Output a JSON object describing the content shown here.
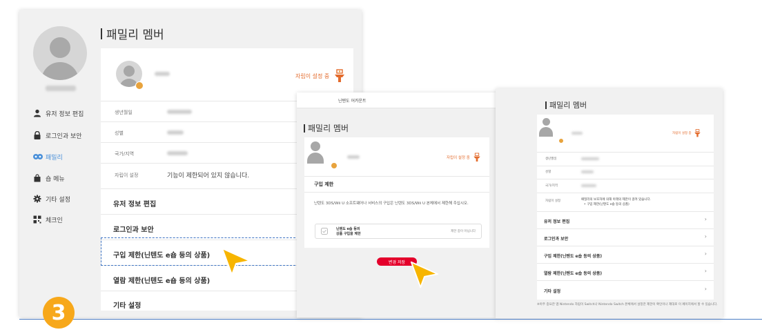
{
  "panel1": {
    "sidebar": {
      "items": [
        {
          "label": "유저 정보 편집",
          "icon": "user-icon"
        },
        {
          "label": "로그인과 보안",
          "icon": "lock-icon"
        },
        {
          "label": "패밀리",
          "icon": "family-icon",
          "active": true
        },
        {
          "label": "숍 메뉴",
          "icon": "shop-bag-icon"
        },
        {
          "label": "기타 설정",
          "icon": "gear-icon"
        },
        {
          "label": "체크인",
          "icon": "checkin-icon"
        }
      ]
    },
    "title": "패밀리 멤버",
    "parental_status": "자립이 설정 중",
    "info_rows": [
      {
        "key": "생년월일"
      },
      {
        "key": "성별"
      },
      {
        "key": "국가/지역"
      },
      {
        "key": "자립이 설정",
        "value": "기능이 제한되어 있지 않습니다."
      }
    ],
    "menu": [
      "유저 정보 편집",
      "로그인과 보안",
      "구입 제한(닌텐도 e숍 등의 상품)",
      "열람 제한(닌텐도 e숍 등의 상품)",
      "기타 설정"
    ]
  },
  "panel2": {
    "topbar": "닌텐도 어카운트",
    "title": "패밀리 멤버",
    "parental_status": "자립이 설정 중",
    "section_title": "구입 제한",
    "description": "닌텐도 3DS/Wii U 소프트웨어나 서비스의 구입은 닌텐도 3DS/Wii U 본체에서 제한해 주십시오.",
    "checkbox_label_line1": "닌텐도 e숍 등의",
    "checkbox_label_line2": "상품 구입을 제한",
    "checkbox_status": "제한 중이 아닙니다",
    "save_button": "변경 저장"
  },
  "panel3": {
    "title": "패밀리 멤버",
    "parental_status": "자립이 설정 중",
    "info_rows": [
      {
        "key": "생년월일"
      },
      {
        "key": "성별"
      },
      {
        "key": "국가/지역"
      },
      {
        "key": "자립이 설정",
        "value": "패밀리의 보호자에 의해 아래의 제한이 걸려 있습니다.",
        "bullet": "구입 제한(닌텐도 e숍 등의 상품)"
      }
    ],
    "menu": [
      "유저 정보 편집",
      "로그인과 보안",
      "구입 제한(닌텐도 e숍 등의 상품)",
      "열람 제한(닌텐도 e숍 등의 상품)",
      "기타 설정"
    ],
    "footnote": "※아주 중요한 앱 Nintendo 자립이 Switch나 Nintendo Switch 본체에서 설정한 제한이 확인이나 제대로 이 페이지에서 할 수 있습니다.",
    "chevron": "›"
  },
  "step_number": "3",
  "colors": {
    "accent_orange": "#e36b2c",
    "step_orange": "#f7a81b",
    "save_red": "#e4002b",
    "dash_blue": "#3b72c2"
  }
}
